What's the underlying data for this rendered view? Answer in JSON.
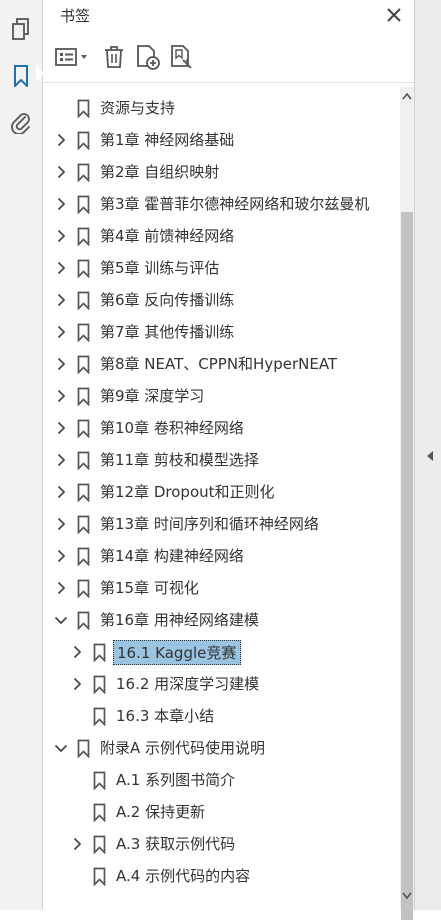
{
  "panel": {
    "title": "书签"
  },
  "rail": {
    "icons": [
      "pages-icon",
      "bookmark-icon",
      "attachment-icon"
    ]
  },
  "toolbar": {
    "icons": [
      "options-menu-icon",
      "delete-icon",
      "new-bookmark-icon",
      "find-bookmark-icon"
    ]
  },
  "colors": {
    "selection": "#9ac4e1",
    "accent": "#1f6fb2",
    "text": "#333333"
  },
  "bookmarks": [
    {
      "label": "资源与支持",
      "level": 0,
      "expander": "none"
    },
    {
      "label": "第1章 神经网络基础",
      "level": 0,
      "expander": "collapsed"
    },
    {
      "label": "第2章 自组织映射",
      "level": 0,
      "expander": "collapsed"
    },
    {
      "label": "第3章 霍普菲尔德神经网络和玻尔兹曼机",
      "level": 0,
      "expander": "collapsed"
    },
    {
      "label": "第4章 前馈神经网络",
      "level": 0,
      "expander": "collapsed"
    },
    {
      "label": "第5章 训练与评估",
      "level": 0,
      "expander": "collapsed"
    },
    {
      "label": "第6章 反向传播训练",
      "level": 0,
      "expander": "collapsed"
    },
    {
      "label": "第7章 其他传播训练",
      "level": 0,
      "expander": "collapsed"
    },
    {
      "label": "第8章 NEAT、CPPN和HyperNEAT",
      "level": 0,
      "expander": "collapsed"
    },
    {
      "label": "第9章 深度学习",
      "level": 0,
      "expander": "collapsed"
    },
    {
      "label": "第10章 卷积神经网络",
      "level": 0,
      "expander": "collapsed"
    },
    {
      "label": "第11章 剪枝和模型选择",
      "level": 0,
      "expander": "collapsed"
    },
    {
      "label": "第12章 Dropout和正则化",
      "level": 0,
      "expander": "collapsed"
    },
    {
      "label": "第13章 时间序列和循环神经网络",
      "level": 0,
      "expander": "collapsed"
    },
    {
      "label": "第14章 构建神经网络",
      "level": 0,
      "expander": "collapsed"
    },
    {
      "label": "第15章 可视化",
      "level": 0,
      "expander": "collapsed"
    },
    {
      "label": "第16章 用神经网络建模",
      "level": 0,
      "expander": "expanded"
    },
    {
      "label": "16.1 Kaggle竞赛",
      "level": 1,
      "expander": "collapsed",
      "selected": true
    },
    {
      "label": "16.2 用深度学习建模",
      "level": 1,
      "expander": "collapsed"
    },
    {
      "label": "16.3 本章小结",
      "level": 1,
      "expander": "none"
    },
    {
      "label": "附录A 示例代码使用说明",
      "level": 0,
      "expander": "expanded"
    },
    {
      "label": "A.1 系列图书简介",
      "level": 1,
      "expander": "none"
    },
    {
      "label": "A.2 保持更新",
      "level": 1,
      "expander": "none"
    },
    {
      "label": "A.3 获取示例代码",
      "level": 1,
      "expander": "collapsed"
    },
    {
      "label": "A.4 示例代码的内容",
      "level": 1,
      "expander": "none"
    }
  ]
}
